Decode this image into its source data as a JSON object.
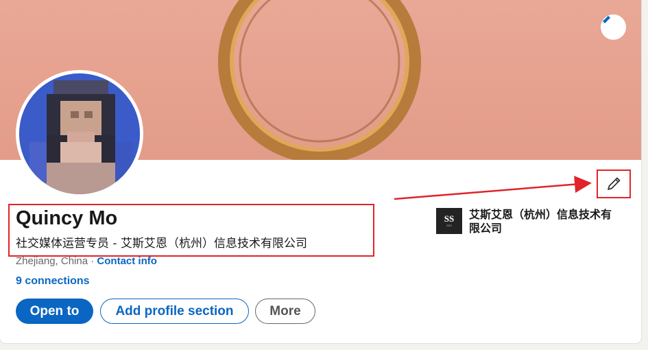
{
  "profile": {
    "name": "Quincy Mo",
    "headline": "社交媒体运营专员 - 艾斯艾恩（杭州）信息技术有限公司",
    "location": "Zhejiang, China",
    "separator": " · ",
    "contact_info_label": "Contact info",
    "connections": "9 connections"
  },
  "actions": {
    "open_to": "Open to",
    "add_profile_section": "Add profile section",
    "more": "More"
  },
  "company": {
    "name": "艾斯艾恩（杭州）信息技术有限公司",
    "logo_mark": "SS",
    "logo_caption": "SSS"
  },
  "icons": {
    "banner_edit": "pencil-icon",
    "intro_edit": "pencil-icon"
  },
  "colors": {
    "accent": "#0a66c2",
    "annotation": "#e0242a",
    "banner": "#e8a593"
  }
}
